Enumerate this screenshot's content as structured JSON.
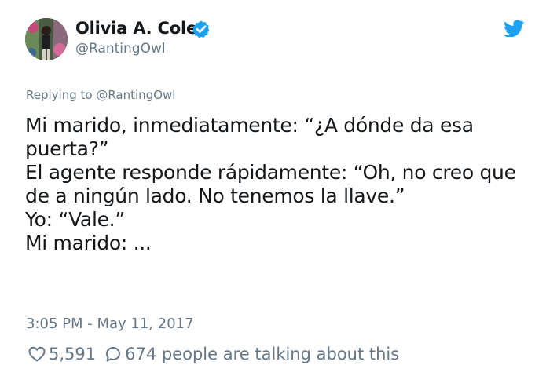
{
  "author": {
    "name": "Olivia A. Cole",
    "handle": "@RantingOwl",
    "verified": true
  },
  "reply": {
    "prefix": "Replying to ",
    "mention": "@RantingOwl"
  },
  "tweet": {
    "lines": [
      "Mi marido, inmediatamente: “¿A dónde da esa",
      "puerta?”",
      "El agente responde rápidamente: “Oh, no creo que",
      "de a ningún lado. No tenemos la llave.”",
      "Yo: “Vale.”",
      "Mi marido: ..."
    ]
  },
  "timestamp": "3:05 PM - May 11, 2017",
  "stats": {
    "likes": "5,591",
    "conversation": "674 people are talking about this"
  },
  "icons": {
    "verified": "verified-badge-icon",
    "brand": "twitter-bird-icon",
    "like": "heart-icon",
    "reply": "comment-bubble-icon"
  },
  "colors": {
    "brand_blue": "#1da1f2",
    "text": "#14171a",
    "muted": "#657786"
  }
}
